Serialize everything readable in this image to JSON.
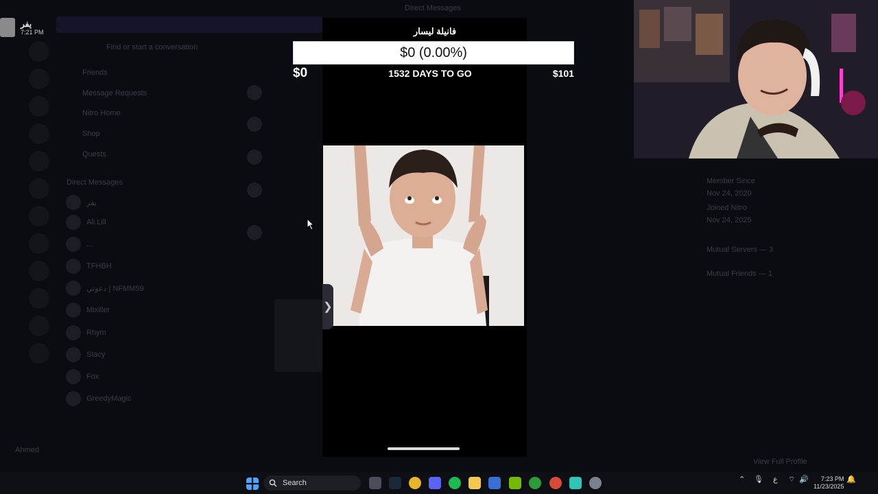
{
  "background": {
    "header": "Direct Messages",
    "search_placeholder": "Find or start a conversation",
    "nav": [
      "Friends",
      "Message Requests",
      "Nitro Home",
      "Shop",
      "Quests"
    ],
    "dm_header": "Direct Messages",
    "dm_list": [
      "يفر",
      "Ali.Lill",
      "...",
      "TFHBH",
      "دعوتي | NFMM59",
      "Mixiller",
      "Rhym",
      "Stacy",
      "Fox",
      "GreedyMagic"
    ],
    "bottom_user": "Ahmed",
    "profile_panel": {
      "member_since_label": "Member Since",
      "member_since_value": "Nov 24, 2020",
      "joined_label": "Joined Nitro",
      "joined_value": "Nov 24, 2025",
      "mutual_servers": "Mutual Servers — 3",
      "mutual_friends": "Mutual Friends — 1",
      "view_full_profile": "View Full Profile"
    }
  },
  "top_user": {
    "name": "يفر",
    "time": "7:21 PM"
  },
  "goal": {
    "title": "فانيلة ليسار",
    "progress_text": "$0 (0.00%)",
    "progress_fraction": 0.0,
    "min": "$0",
    "days_left": "1532 DAYS TO GO",
    "max": "$101"
  },
  "taskbar": {
    "search_label": "Search",
    "tray_lang": "ع",
    "time": "7:23 PM",
    "date": "11/23/2025"
  },
  "colors": {
    "overlay_bg": "#000000",
    "goal_bar": "#ffffff",
    "app_bg": "#0b0c12"
  },
  "icons": [
    "windows-start-icon",
    "search-icon",
    "camera-icon",
    "steam-icon",
    "chrome-icon",
    "discord-icon",
    "spotify-icon",
    "file-explorer-icon",
    "store-icon",
    "nvidia-icon",
    "xbox-icon",
    "chrome-icon",
    "app-icon",
    "settings-icon"
  ]
}
